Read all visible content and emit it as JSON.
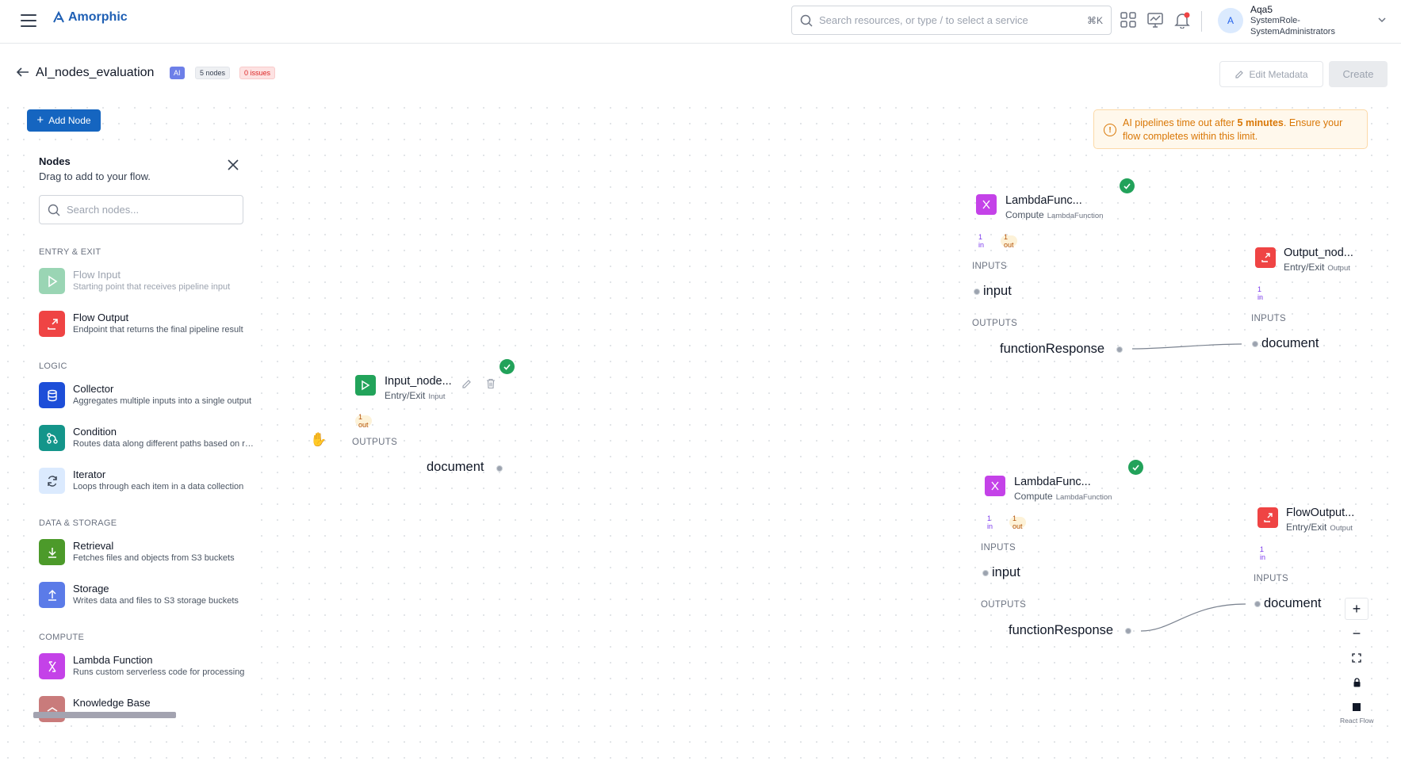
{
  "header": {
    "logo_text": "Amorphic",
    "search_placeholder": "Search resources, or type / to select a service",
    "search_shortcut": "⌘K",
    "user_initial": "A",
    "user_name": "Aqa5",
    "user_role_line1": "SystemRole-",
    "user_role_line2": "SystemAdministrators"
  },
  "page": {
    "title": "AI_nodes_evaluation",
    "badge_ai": "AI",
    "badge_nodes": "5 nodes",
    "badge_issues": "0 issues",
    "edit_metadata": "Edit Metadata",
    "create": "Create",
    "add_node": "Add Node"
  },
  "panel": {
    "title": "Nodes",
    "subtitle": "Drag to add to your flow.",
    "search_placeholder": "Search nodes...",
    "sections": {
      "entry": "ENTRY & EXIT",
      "logic": "LOGIC",
      "data": "DATA & STORAGE",
      "compute": "COMPUTE"
    },
    "items": [
      {
        "title": "Flow Input",
        "desc": "Starting point that receives pipeline input",
        "icon": "play-icon",
        "color": "#22a35a"
      },
      {
        "title": "Flow Output",
        "desc": "Endpoint that returns the final pipeline result",
        "icon": "output-icon",
        "color": "#ef4444"
      },
      {
        "title": "Collector",
        "desc": "Aggregates multiple inputs into a single output",
        "icon": "database-icon",
        "color": "#1d4ed8"
      },
      {
        "title": "Condition",
        "desc": "Routes data along different paths based on rules",
        "icon": "branch-icon",
        "color": "#14958a"
      },
      {
        "title": "Iterator",
        "desc": "Loops through each item in a data collection",
        "icon": "loop-icon",
        "color": "#dbeafe"
      },
      {
        "title": "Retrieval",
        "desc": "Fetches files and objects from S3 buckets",
        "icon": "download-icon",
        "color": "#4c9a2a"
      },
      {
        "title": "Storage",
        "desc": "Writes data and files to S3 storage buckets",
        "icon": "upload-icon",
        "color": "#5b7be8"
      },
      {
        "title": "Lambda Function",
        "desc": "Runs custom serverless code for processing",
        "icon": "lambda-icon",
        "color": "#c442e8"
      },
      {
        "title": "Knowledge Base",
        "desc": "",
        "icon": "knowledge-icon",
        "color": "#c97b7b"
      }
    ]
  },
  "warning": {
    "pre": "AI pipelines time out after ",
    "bold": "5 minutes",
    "post": ". Ensure your flow completes within this limit."
  },
  "nodes": {
    "input": {
      "name": "Input_node...",
      "category": "Entry/Exit",
      "type": "Input",
      "out_tag": "1 out",
      "outputs_label": "OUTPUTS",
      "port": "document"
    },
    "lambda1": {
      "name": "LambdaFunc...",
      "category": "Compute",
      "type": "LambdaFunction",
      "in_tag": "1 in",
      "out_tag": "1 out",
      "inputs_label": "INPUTS",
      "in_port": "input",
      "outputs_label": "OUTPUTS",
      "out_port": "functionResponse"
    },
    "output1": {
      "name": "Output_nod...",
      "category": "Entry/Exit",
      "type": "Output",
      "in_tag": "1 in",
      "inputs_label": "INPUTS",
      "port": "document"
    },
    "lambda2": {
      "name": "LambdaFunc...",
      "category": "Compute",
      "type": "LambdaFunction",
      "in_tag": "1 in",
      "out_tag": "1 out",
      "inputs_label": "INPUTS",
      "in_port": "input",
      "outputs_label": "OUTPUTS",
      "out_port": "functionResponse"
    },
    "output2": {
      "name": "FlowOutput...",
      "category": "Entry/Exit",
      "type": "Output",
      "in_tag": "1 in",
      "inputs_label": "INPUTS",
      "port": "document"
    }
  },
  "controls": {
    "zoom_in": "+",
    "zoom_out": "−",
    "attribution": "React Flow"
  }
}
